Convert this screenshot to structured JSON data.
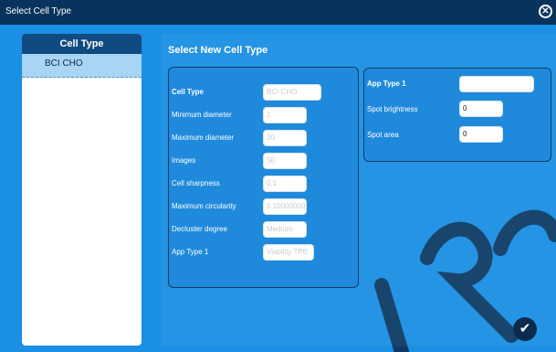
{
  "window": {
    "title": "Select Cell Type",
    "close_glyph": "✕"
  },
  "sidebar": {
    "header": "Cell Type",
    "items": [
      {
        "label": "BCI CHO",
        "selected": true
      }
    ]
  },
  "content": {
    "title": "Select New Cell Type",
    "left_fields": [
      {
        "label": "Cell Type",
        "value": "BCI CHO",
        "bold": true
      },
      {
        "label": "Minimum diameter",
        "value": "1"
      },
      {
        "label": "Maximum diameter",
        "value": "30"
      },
      {
        "label": "Images",
        "value": "50"
      },
      {
        "label": "Cell sharpness",
        "value": "0.1"
      },
      {
        "label": "Maximum circularity",
        "value": "0.10000000"
      },
      {
        "label": "Decluster degree",
        "value": "Medium"
      },
      {
        "label": "App Type 1",
        "value": "Viability TPB"
      }
    ],
    "right_fields": [
      {
        "label": "App Type 1",
        "value": "",
        "bold": true
      },
      {
        "label": "Spot brightness",
        "value": "0"
      },
      {
        "label": "Spot area",
        "value": "0"
      }
    ],
    "confirm_glyph": "✔"
  },
  "colors": {
    "titlebar": "#08335c",
    "background": "#1a8fe3",
    "sidebar_header": "#0f4b80",
    "sidebar_selected": "#a8d4f6"
  },
  "watermark_icon": "watermark-text"
}
